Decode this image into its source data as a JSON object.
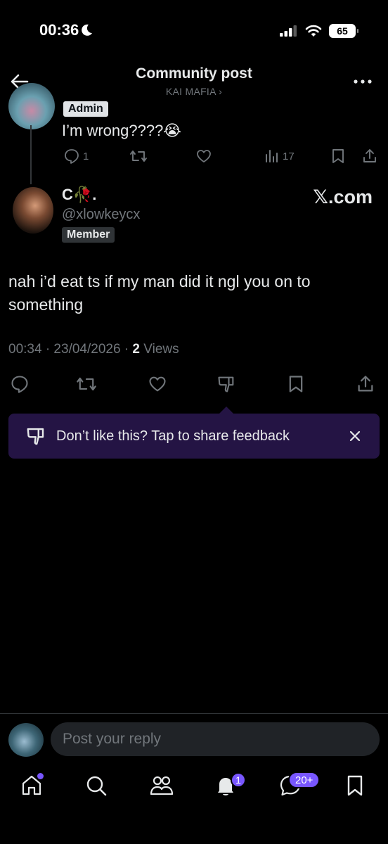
{
  "status_bar": {
    "time": "00:36",
    "battery": "65"
  },
  "header": {
    "title": "Community post",
    "subtitle": "KAI MAFIA ›"
  },
  "parent_post": {
    "role_badge": "Admin",
    "text": "I’m wrong????😭",
    "replies": "1",
    "views": "17"
  },
  "reply_post": {
    "display_name": "C🥀.",
    "handle": "@xlowkeycx",
    "role_badge": "Member",
    "watermark": "𝕏.com",
    "text": "nah i’d eat ts if my man did it ngl you on to something",
    "timestamp": "00:34 · 23/04/2026 · ",
    "views_count": "2",
    "views_label": " Views"
  },
  "feedback_banner": {
    "text": "Don’t like this? Tap to share feedback"
  },
  "reply_bar": {
    "placeholder": "Post your reply"
  },
  "tab_bar": {
    "notifications_badge": "1",
    "messages_badge": "20+"
  },
  "colors": {
    "accent": "#7856ff",
    "banner_bg": "#241444",
    "muted": "#71767b",
    "text": "#e7e9ea"
  }
}
